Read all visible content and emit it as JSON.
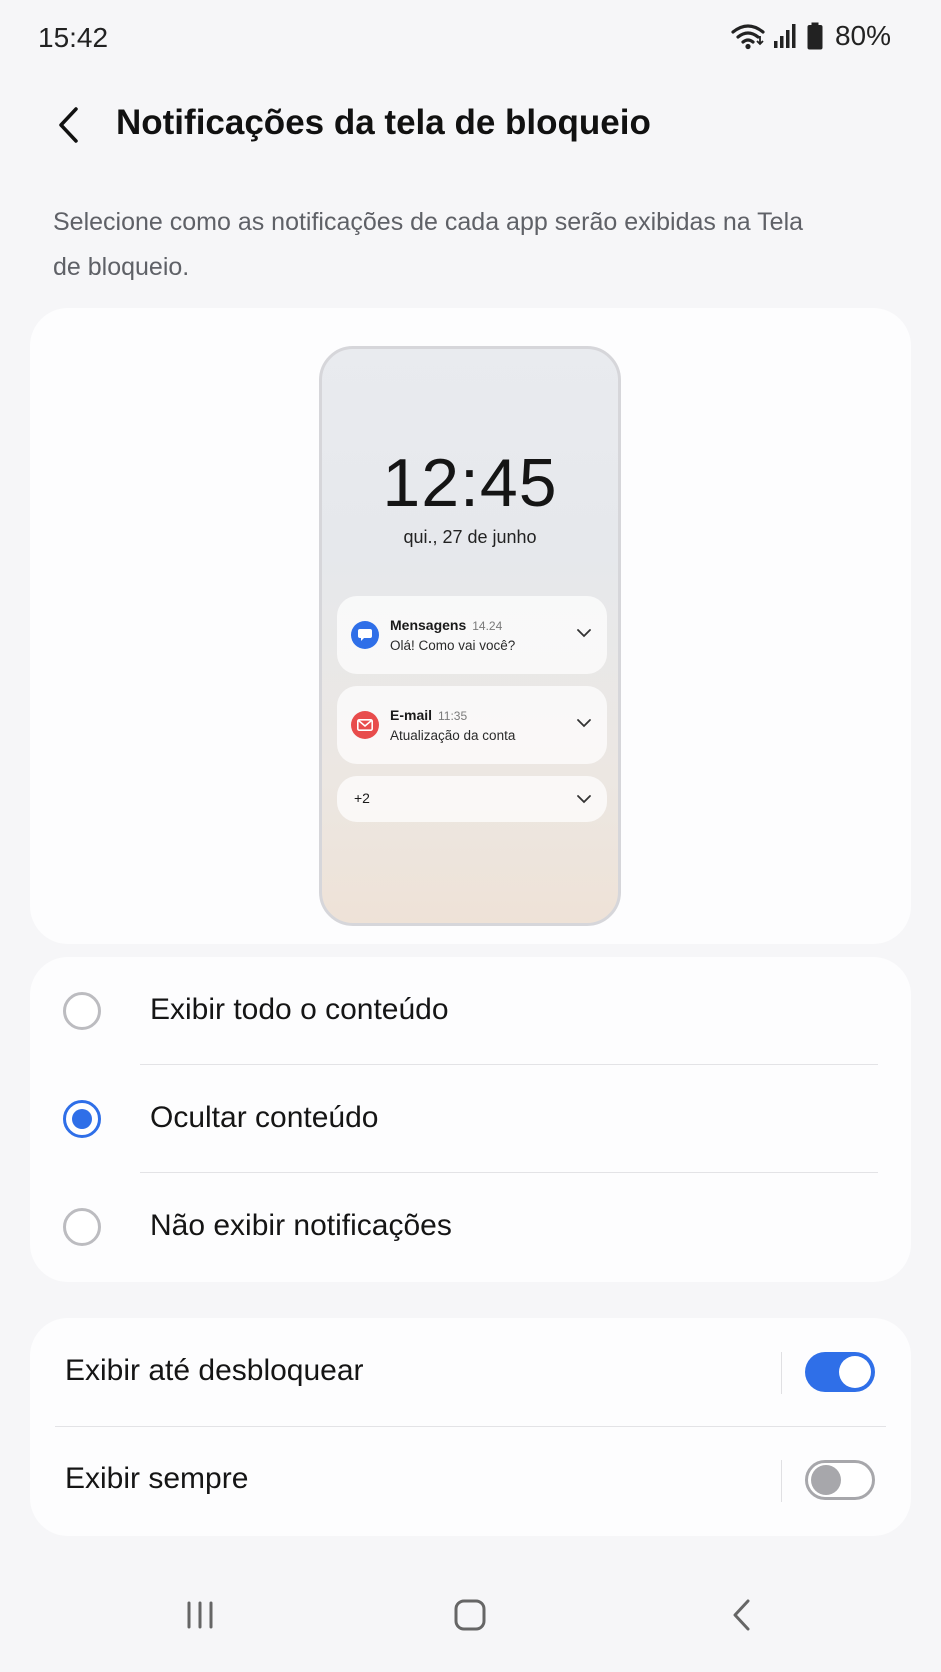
{
  "status_bar": {
    "time": "15:42",
    "battery": "80%",
    "icons": [
      "wifi-icon",
      "signal-icon",
      "battery-icon"
    ]
  },
  "header": {
    "title": "Notificações da tela de bloqueio",
    "back_icon": "back-arrow-icon"
  },
  "description": "Selecione como as notificações de cada app serão exibidas na Tela de bloqueio.",
  "preview": {
    "clock": "12:45",
    "date": "qui., 27 de junho",
    "notifications": [
      {
        "app": "Mensagens",
        "time": "14.24",
        "text": "Olá! Como vai você?",
        "icon": "message-icon",
        "color": "#2f6fe8"
      },
      {
        "app": "E-mail",
        "time": "11:35",
        "text": "Atualização da conta",
        "icon": "mail-icon",
        "color": "#e84c4c"
      }
    ],
    "more_count": "+2"
  },
  "options": {
    "items": [
      {
        "label": "Exibir todo o conteúdo",
        "selected": false
      },
      {
        "label": "Ocultar conteúdo",
        "selected": true
      },
      {
        "label": "Não exibir notificações",
        "selected": false
      }
    ]
  },
  "toggles": {
    "items": [
      {
        "label": "Exibir até desbloquear",
        "on": true
      },
      {
        "label": "Exibir sempre",
        "on": false
      }
    ]
  },
  "nav_bar": {
    "buttons": [
      "recents-icon",
      "home-icon",
      "back-icon"
    ]
  },
  "colors": {
    "accent": "#2f6fe8",
    "background": "#f6f6f8",
    "card": "#fdfdfe"
  }
}
